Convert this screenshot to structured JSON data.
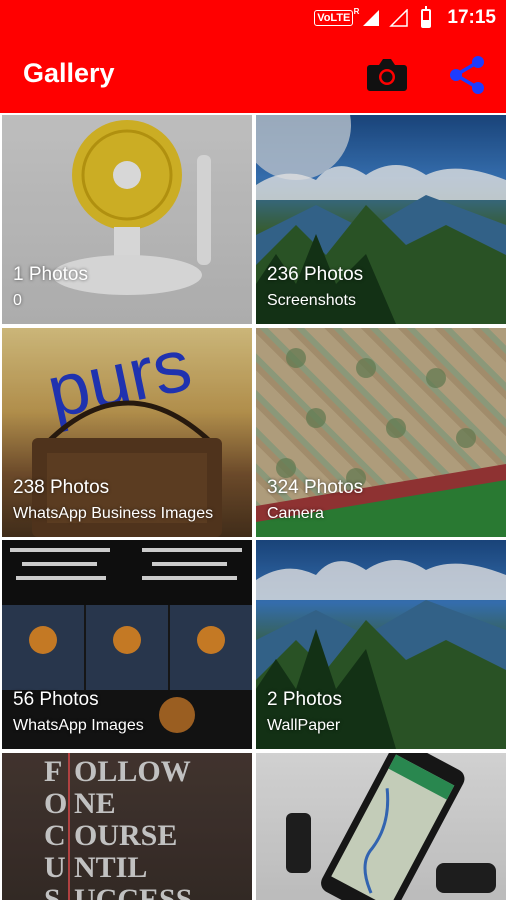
{
  "status_bar": {
    "volte": "VoLTE",
    "volte_sup": "R",
    "time": "17:15",
    "battery_level": 0.35
  },
  "app_bar": {
    "title": "Gallery",
    "camera_icon": "camera-icon",
    "share_icon": "share-icon"
  },
  "albums": [
    {
      "count": "1 Photos",
      "name": "0"
    },
    {
      "count": "236 Photos",
      "name": "Screenshots"
    },
    {
      "count": "238 Photos",
      "name": "WhatsApp Business Images"
    },
    {
      "count": "324 Photos",
      "name": "Camera"
    },
    {
      "count": "56 Photos",
      "name": "WhatsApp Images"
    },
    {
      "count": "2 Photos",
      "name": "WallPaper"
    },
    {
      "count": "",
      "name": ""
    },
    {
      "count": "",
      "name": ""
    }
  ],
  "tile_art": {
    "bag_text": "purs",
    "focus_letters": [
      "F",
      "O",
      "C",
      "U",
      "S"
    ],
    "focus_words": [
      "OLLOW",
      "NE",
      "OURSE",
      "NTIL",
      "UCCESS"
    ]
  },
  "colors": {
    "app_bar": "#ff0000",
    "icon_camera": "#111111",
    "icon_share": "#1e3cff"
  }
}
